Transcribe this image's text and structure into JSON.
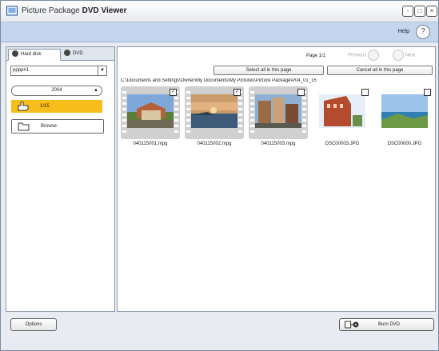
{
  "window": {
    "title_prefix": "Picture Package ",
    "title_bold": "DVD Viewer",
    "minimize": "-",
    "restore": "□",
    "close": "×"
  },
  "help": {
    "label": "Help",
    "button": "?"
  },
  "left": {
    "tabs": [
      {
        "label": "Hard disk"
      },
      {
        "label": "DVD"
      }
    ],
    "folder_select": "pppp#1",
    "year": "2004",
    "items": [
      {
        "label": "1/15"
      },
      {
        "label": "Browse"
      }
    ]
  },
  "content": {
    "page": "Page 1/1",
    "previous": "Previous",
    "next": "Next",
    "select_all": "Select all in this page",
    "cancel_all": "Cancel all in this page",
    "path": "C:\\Documents and Settings\\Owner\\My Documents\\My Pictures\\Picture Package\\P04_01_15",
    "thumbnails": [
      {
        "caption": "040115001.mpg",
        "type": "video",
        "checked": true
      },
      {
        "caption": "040115002.mpg",
        "type": "video",
        "checked": true
      },
      {
        "caption": "040115003.mpg",
        "type": "video",
        "checked": false
      },
      {
        "caption": "DSC00003.JPG",
        "type": "photo",
        "checked": false
      },
      {
        "caption": "DSC00000.JPG",
        "type": "photo",
        "checked": false
      }
    ]
  },
  "bottom": {
    "options": "Options",
    "burn": "Burn DVD"
  },
  "colors": {
    "banner": "#c4d6ee",
    "selected": "#f7bd1b"
  },
  "icons": {
    "app": "dvd-viewer-icon",
    "help": "help-icon",
    "hand": "hand-pointer-icon",
    "burn": "burn-dvd-icon"
  }
}
